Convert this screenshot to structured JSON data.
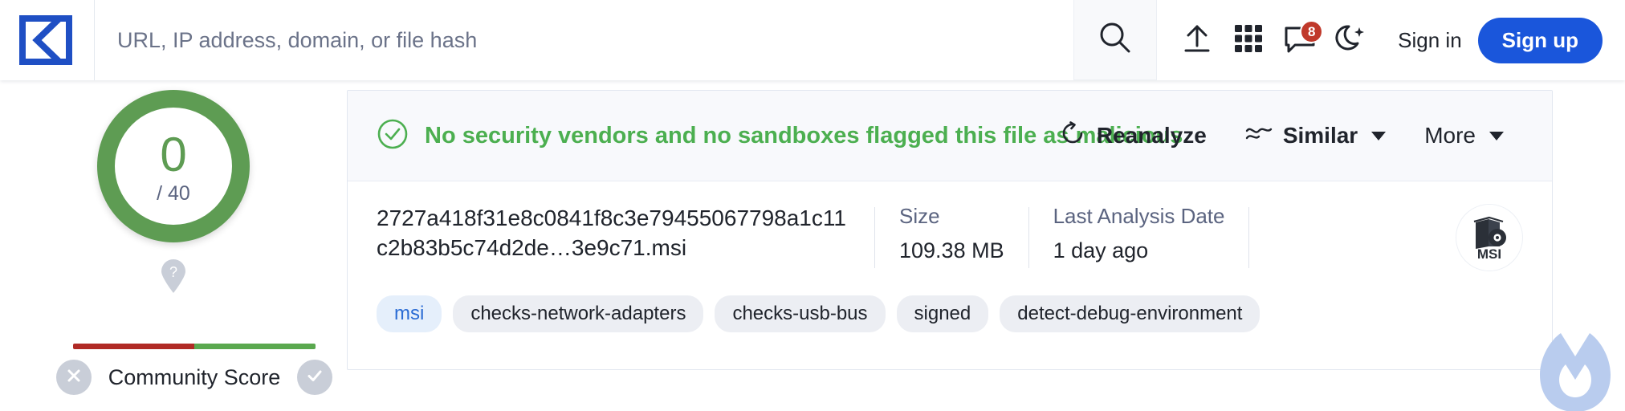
{
  "header": {
    "logo_name": "virustotal-logo",
    "search": {
      "placeholder": "URL, IP address, domain, or file hash",
      "value": ""
    },
    "icons": {
      "search": "search-icon",
      "upload": "upload-icon",
      "apps": "apps-grid-icon",
      "comments": "comment-bubble-icon",
      "theme": "moon-dark-mode-icon"
    },
    "notification_count": "8",
    "sign_in_label": "Sign in",
    "sign_up_label": "Sign up",
    "accent_color": "#1a56db",
    "badge_color": "#c0392b"
  },
  "score": {
    "detections": "0",
    "total": "/ 40",
    "ring_color": "#5e9c53",
    "help_icon": "help-pin-icon",
    "community_label": "Community Score",
    "downvote_icon": "x-circle-icon",
    "upvote_icon": "check-circle-icon",
    "bar_negative_color": "#b02a25",
    "bar_positive_color": "#5aa84f"
  },
  "report": {
    "verdict_text": "No security vendors and no sandboxes flagged this file as malicious",
    "verdict_color": "#4caf50",
    "verdict_icon": "check-circle-icon",
    "actions": [
      {
        "label": "Reanalyze",
        "icon": "refresh-icon",
        "caret": false
      },
      {
        "label": "Similar",
        "icon": "similar-waves-icon",
        "caret": true
      },
      {
        "label": "More",
        "icon": "",
        "caret": true
      }
    ],
    "file_name": "2727a418f31e8c0841f8c3e79455067798a1c11c2b83b5c74d2de…3e9c71.msi",
    "size_label": "Size",
    "size_value": "109.38 MB",
    "last_analysis_label": "Last Analysis Date",
    "last_analysis_value": "1 day ago",
    "file_type_icon": "msi-file-icon",
    "file_type_text": "MSI",
    "tags": [
      {
        "label": "msi",
        "accent": true
      },
      {
        "label": "checks-network-adapters",
        "accent": false
      },
      {
        "label": "checks-usb-bus",
        "accent": false
      },
      {
        "label": "signed",
        "accent": false
      },
      {
        "label": "detect-debug-environment",
        "accent": false
      }
    ]
  },
  "watermark": {
    "name": "malwarebytes-logo-watermark",
    "color": "#b9ccee"
  }
}
